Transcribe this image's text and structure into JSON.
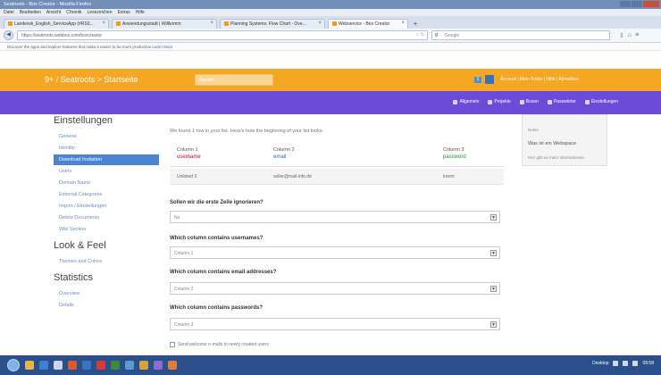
{
  "browser": {
    "window_title": "Seatroots - Box Creator - Mozilla Firefox",
    "menu": [
      "Datei",
      "Bearbeiten",
      "Ansicht",
      "Chronik",
      "Lesezeichen",
      "Extras",
      "Hilfe"
    ],
    "tabs": [
      {
        "label": "Landesvk_English_ServiceApp (#RS0...",
        "active": false
      },
      {
        "label": "Anwendungsstadt | Willkomm",
        "active": false
      },
      {
        "label": "Planning Systems: Flow Chart - Ove...",
        "active": false
      },
      {
        "label": "Webservice - Box Creator",
        "active": true
      }
    ],
    "url": "https://seatroots.webbox.com/boxcreator",
    "search_placeholder": "Google",
    "notice_text": "Discover the apps and explore features that make it easier to be more productive",
    "notice_link": "Learn More"
  },
  "app": {
    "brand": "9+ / Seatroots > Startseite",
    "search_placeholder": "Suchen",
    "notification_count": "1",
    "user_links": "Account | Mein Konto | Hilfe | Abmelden",
    "nav": [
      {
        "label": "Allgemein",
        "icon": "globe-icon"
      },
      {
        "label": "Projekte",
        "icon": "user-icon"
      },
      {
        "label": "Boxen",
        "icon": "grid-icon"
      },
      {
        "label": "Passwörter",
        "icon": "list-icon"
      },
      {
        "label": "Einstellungen",
        "icon": "gear-icon"
      }
    ]
  },
  "sidebar": {
    "section_settings": "Einstellungen",
    "settings_items": [
      {
        "label": "General",
        "active": false
      },
      {
        "label": "Identity",
        "active": false
      },
      {
        "label": "Download Invitation",
        "active": true
      },
      {
        "label": "Users",
        "active": false
      },
      {
        "label": "Domain Name",
        "active": false
      },
      {
        "label": "External Categories",
        "active": false
      },
      {
        "label": "Import / Einstellungen",
        "active": false
      },
      {
        "label": "Delete Documents",
        "active": false
      },
      {
        "label": "Wiki Section",
        "active": false
      }
    ],
    "section_look": "Look & Feel",
    "look_items": [
      {
        "label": "Themes and Colors",
        "active": false
      }
    ],
    "section_stats": "Statistics",
    "stats_items": [
      {
        "label": "Overview",
        "active": false
      },
      {
        "label": "Details",
        "active": false
      }
    ]
  },
  "main": {
    "intro": "We found 1 row in your list. Here's how the beginning of your list looks:",
    "columns": [
      {
        "header": "Column 1",
        "name": "username",
        "color": "#d0021b"
      },
      {
        "header": "Column 2",
        "name": "email",
        "color": "#3466b8"
      },
      {
        "header": "Column 3",
        "name": "password",
        "color": "#2e8b3c"
      }
    ],
    "row": [
      "Unlisted 3",
      "seller@mail-info.de",
      "lorem"
    ],
    "questions": [
      {
        "label": "Sollen wir die erste Zeile ignorieren?",
        "value": "No"
      },
      {
        "label": "Which column contains usernames?",
        "value": "Column 1"
      },
      {
        "label": "Which column contains email addresses?",
        "value": "Column 2"
      },
      {
        "label": "Which column contains passwords?",
        "value": "Column 3"
      }
    ],
    "checkbox_label": "Send welcome e-mails to newly created users"
  },
  "right_panel": {
    "title": "Notes",
    "link": "Was ist ein Webspace",
    "small": "Hier gibt es mehr Informationen"
  },
  "taskbar": {
    "tray_text": "Desktop",
    "time": "09:58"
  }
}
